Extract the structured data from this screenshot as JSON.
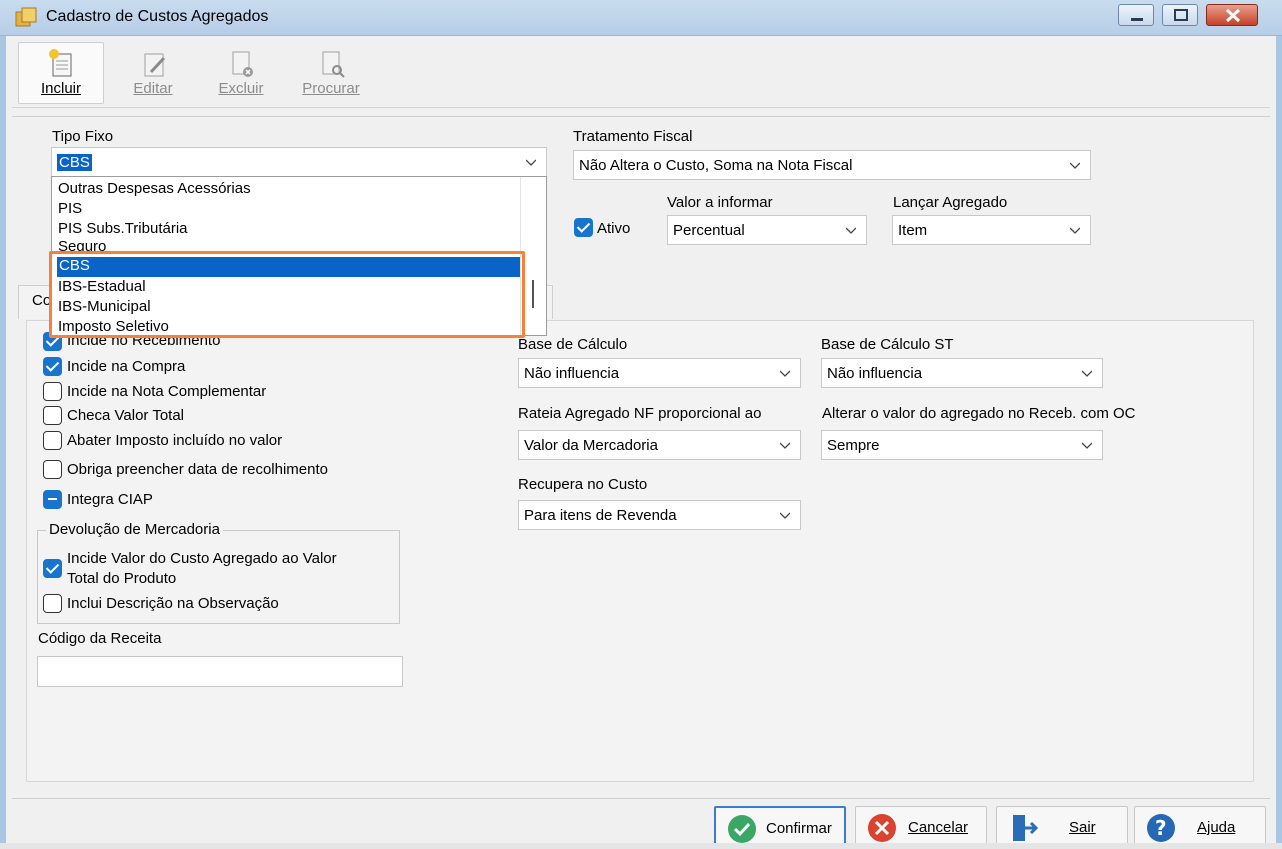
{
  "window": {
    "title": "Cadastro de Custos Agregados"
  },
  "toolbar": {
    "buttons": [
      {
        "label": "Incluir",
        "icon": "new-document-icon",
        "enabled": true
      },
      {
        "label": "Editar",
        "icon": "edit-document-icon",
        "enabled": false
      },
      {
        "label": "Excluir",
        "icon": "delete-document-icon",
        "enabled": false
      },
      {
        "label": "Procurar",
        "icon": "search-document-icon",
        "enabled": false
      }
    ]
  },
  "form": {
    "tipo_fixo": {
      "label": "Tipo Fixo",
      "value": "CBS"
    },
    "tratamento_fiscal": {
      "label": "Tratamento Fiscal",
      "value": "Não Altera o Custo, Soma na Nota Fiscal"
    },
    "ativo": {
      "label": "Ativo",
      "checked": true
    },
    "valor_a_informar": {
      "label": "Valor a informar",
      "value": "Percentual"
    },
    "lancar_agregado": {
      "label": "Lançar Agregado",
      "value": "Item"
    },
    "tab_stub": "Co"
  },
  "dropdown": {
    "items": [
      "Outras Despesas Acessórias",
      "PIS",
      "PIS Subs.Tributária",
      "Seguro",
      "CBS",
      "IBS-Estadual",
      "IBS-Municipal",
      "Imposto Seletivo"
    ],
    "selected": "CBS",
    "highlight_color": "#f5823b"
  },
  "checkboxes": [
    {
      "label": "Incide no Recebimento",
      "state": "checked"
    },
    {
      "label": "Incide na Compra",
      "state": "checked"
    },
    {
      "label": "Incide na Nota Complementar",
      "state": "unchecked"
    },
    {
      "label": "Checa Valor Total",
      "state": "unchecked"
    },
    {
      "label": "Abater Imposto incluído no valor",
      "state": "unchecked"
    },
    {
      "label": "Obriga preencher data de recolhimento",
      "state": "unchecked"
    },
    {
      "label": "Integra CIAP",
      "state": "indeterminate"
    }
  ],
  "devolucao": {
    "title": "Devolução de Mercadoria",
    "incide_line1": "Incide Valor do Custo Agregado ao Valor",
    "incide_line2": "Total do Produto",
    "incide_checked": true,
    "inclui": "Inclui Descrição na Observação",
    "inclui_checked": false
  },
  "codigo_receita": {
    "label": "Código da Receita",
    "value": ""
  },
  "right_fields": {
    "base_calculo": {
      "label": "Base de Cálculo",
      "value": "Não influencia"
    },
    "base_calculo_st": {
      "label": "Base de Cálculo ST",
      "value": "Não influencia"
    },
    "rateia": {
      "label": "Rateia Agregado NF proporcional ao",
      "value": "Valor da Mercadoria"
    },
    "alterar": {
      "label": "Alterar o valor do agregado no Receb. com OC",
      "value": "Sempre"
    },
    "recupera": {
      "label": "Recupera no Custo",
      "value": "Para itens de Revenda"
    }
  },
  "bottom_buttons": [
    {
      "label": "Confirmar",
      "icon": "check-circle-icon"
    },
    {
      "label": "Cancelar",
      "icon": "cancel-circle-icon"
    },
    {
      "label": "Sair",
      "icon": "exit-door-icon"
    },
    {
      "label": "Ajuda",
      "icon": "help-circle-icon"
    }
  ],
  "colors": {
    "accent": "#1874cd",
    "selection": "#0a64c8",
    "highlight": "#f5823b"
  }
}
